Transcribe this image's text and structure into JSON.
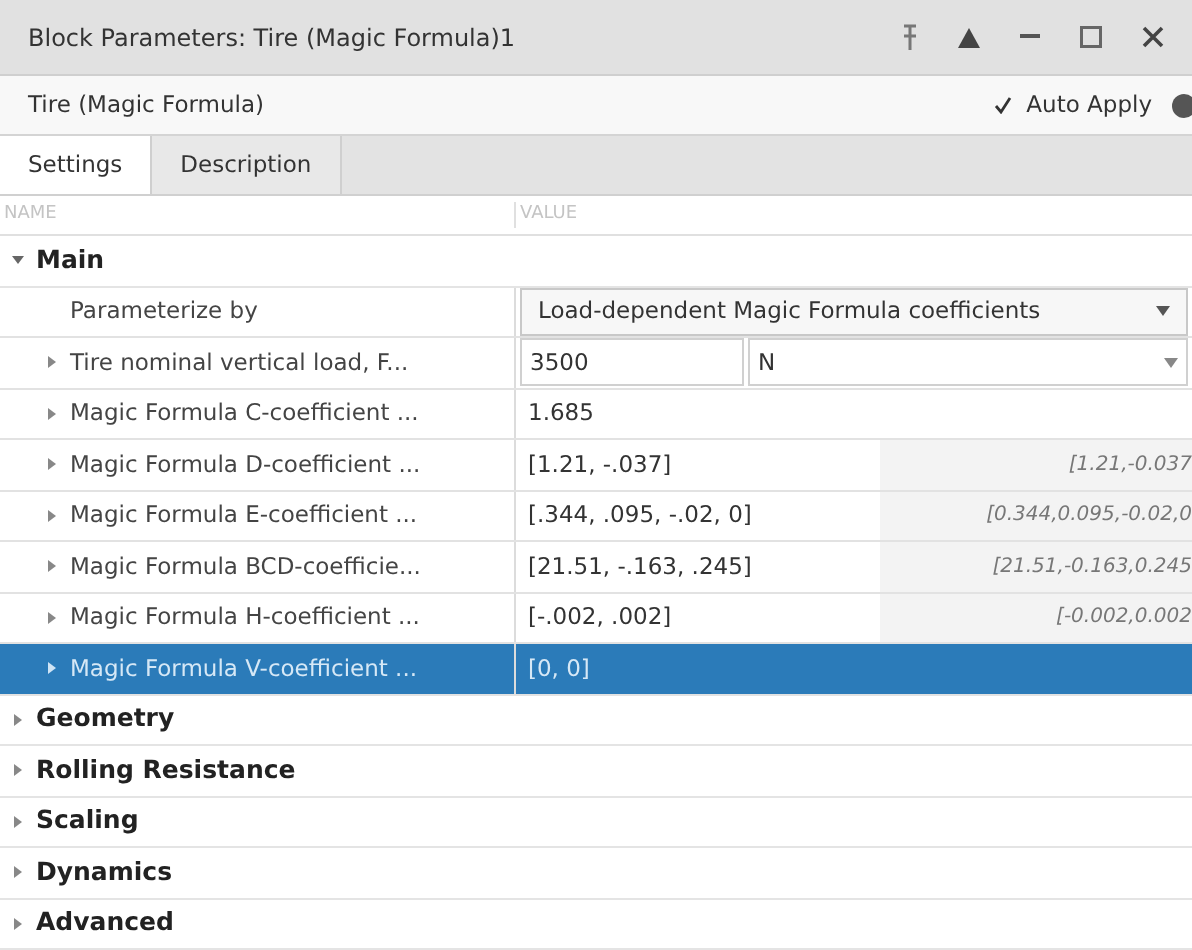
{
  "window": {
    "title": "Block Parameters: Tire (Magic Formula)1"
  },
  "header": {
    "block_name": "Tire (Magic Formula)",
    "auto_apply": {
      "label": "Auto Apply",
      "checked": true
    }
  },
  "tabs": [
    {
      "label": "Settings",
      "selected": true
    },
    {
      "label": "Description",
      "selected": false
    }
  ],
  "table": {
    "columns": [
      "NAME",
      "VALUE"
    ],
    "sections": [
      {
        "title": "Main",
        "expanded": true,
        "rows": [
          {
            "kind": "dropdown",
            "name": "Parameterize by",
            "value": "Load-dependent Magic Formula coefficients",
            "selected": false
          },
          {
            "kind": "unit",
            "name": "Tire nominal vertical load, F...",
            "value": "3500",
            "unit": "N",
            "selected": false
          },
          {
            "kind": "plain",
            "name": "Magic Formula C-coefficient ...",
            "value": "1.685",
            "selected": false
          },
          {
            "kind": "evaluated",
            "name": "Magic Formula D-coefficient ...",
            "value": "[1.21, -.037]",
            "evaluated": "[1.21,-0.037",
            "selected": false
          },
          {
            "kind": "evaluated",
            "name": "Magic Formula E-coefficient ...",
            "value": "[.344, .095, -.02, 0]",
            "evaluated": "[0.344,0.095,-0.02,0",
            "selected": false
          },
          {
            "kind": "evaluated",
            "name": "Magic Formula BCD-coefficie...",
            "value": "[21.51, -.163, .245]",
            "evaluated": "[21.51,-0.163,0.245",
            "selected": false
          },
          {
            "kind": "evaluated",
            "name": "Magic Formula H-coefficient ...",
            "value": "[-.002, .002]",
            "evaluated": "[-0.002,0.002",
            "selected": false
          },
          {
            "kind": "plain",
            "name": "Magic Formula V-coefficient ...",
            "value": "[0, 0]",
            "selected": true
          }
        ]
      },
      {
        "title": "Geometry",
        "expanded": false
      },
      {
        "title": "Rolling Resistance",
        "expanded": false
      },
      {
        "title": "Scaling",
        "expanded": false
      },
      {
        "title": "Dynamics",
        "expanded": false
      },
      {
        "title": "Advanced",
        "expanded": false
      }
    ]
  }
}
